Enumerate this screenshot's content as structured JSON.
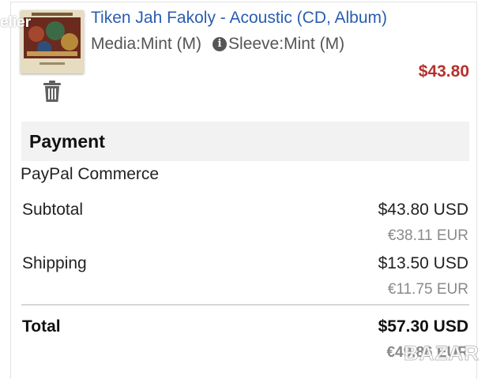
{
  "item": {
    "thumbnail_icon": "album-cover-image",
    "title": "Tiken Jah Fakoly - Acoustic (CD, Album)",
    "media_condition": "Media:Mint (M)",
    "sleeve_condition": "Sleeve:Mint (M)",
    "price": "$43.80",
    "remove_icon": "trash-icon"
  },
  "payment": {
    "heading": "Payment",
    "method": "PayPal Commerce",
    "rows": [
      {
        "label": "Subtotal",
        "usd": "$43.80 USD",
        "eur": "€38.11 EUR"
      },
      {
        "label": "Shipping",
        "usd": "$13.50 USD",
        "eur": "€11.75 EUR"
      }
    ],
    "total": {
      "label": "Total",
      "usd": "$57.30 USD",
      "eur": "€49.86 EUR"
    }
  },
  "watermarks": {
    "left": "elier",
    "right": "BAZAR"
  },
  "colors": {
    "link": "#2a5db0",
    "price": "#b5312c",
    "header_bg": "#f2f2f2",
    "muted": "#8a8a8a"
  }
}
